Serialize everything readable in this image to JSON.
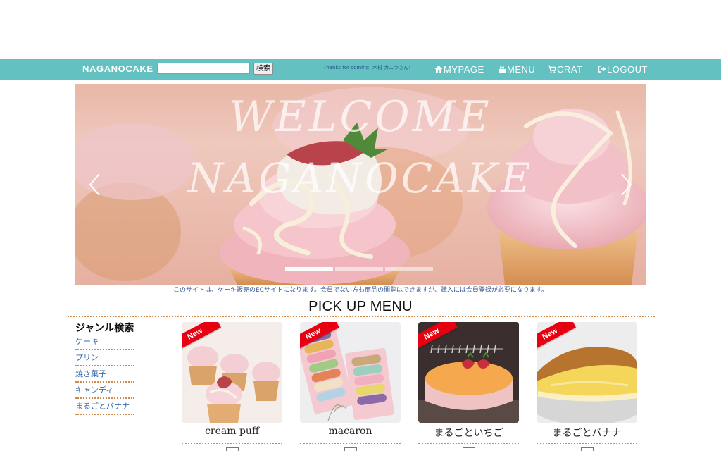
{
  "header": {
    "brand": "NAGANOCAKE",
    "search": {
      "value": "",
      "button_label": "検索"
    },
    "greeting": "Thanks for coming! 木村 カエラさん！",
    "nav": [
      {
        "label": "MYPAGE",
        "icon": "home-icon"
      },
      {
        "label": "MENU",
        "icon": "cake-icon"
      },
      {
        "label": "CRAT",
        "icon": "cart-icon"
      },
      {
        "label": "LOGOUT",
        "icon": "logout-icon"
      }
    ],
    "colors": {
      "nav_bg": "#63c1c1",
      "nav_text": "#ffffff"
    }
  },
  "carousel": {
    "line1": "WELCOME",
    "line2": "NAGANOCAKE",
    "slides_count": 3,
    "active_index": 0
  },
  "notice": "このサイトは、ケーキ販売のECサイトになります。会員でない方も商品の閲覧はできますが、購入には会員登録が必要になります。",
  "pickup": {
    "title": "PICK UP MENU",
    "items": [
      {
        "badge": "New",
        "name": "cream puff"
      },
      {
        "badge": "New",
        "name": "macaron"
      },
      {
        "badge": "New",
        "name": "まるごといちご"
      },
      {
        "badge": "New",
        "name": "まるごとバナナ"
      }
    ]
  },
  "genre": {
    "title": "ジャンル検索",
    "items": [
      "ケーキ",
      "プリン",
      "焼き菓子",
      "キャンディ",
      "まるごとバナナ"
    ]
  },
  "colors": {
    "accent_dots": "#d28a4a",
    "link": "#3a6aa8",
    "badge": "#e60012"
  }
}
